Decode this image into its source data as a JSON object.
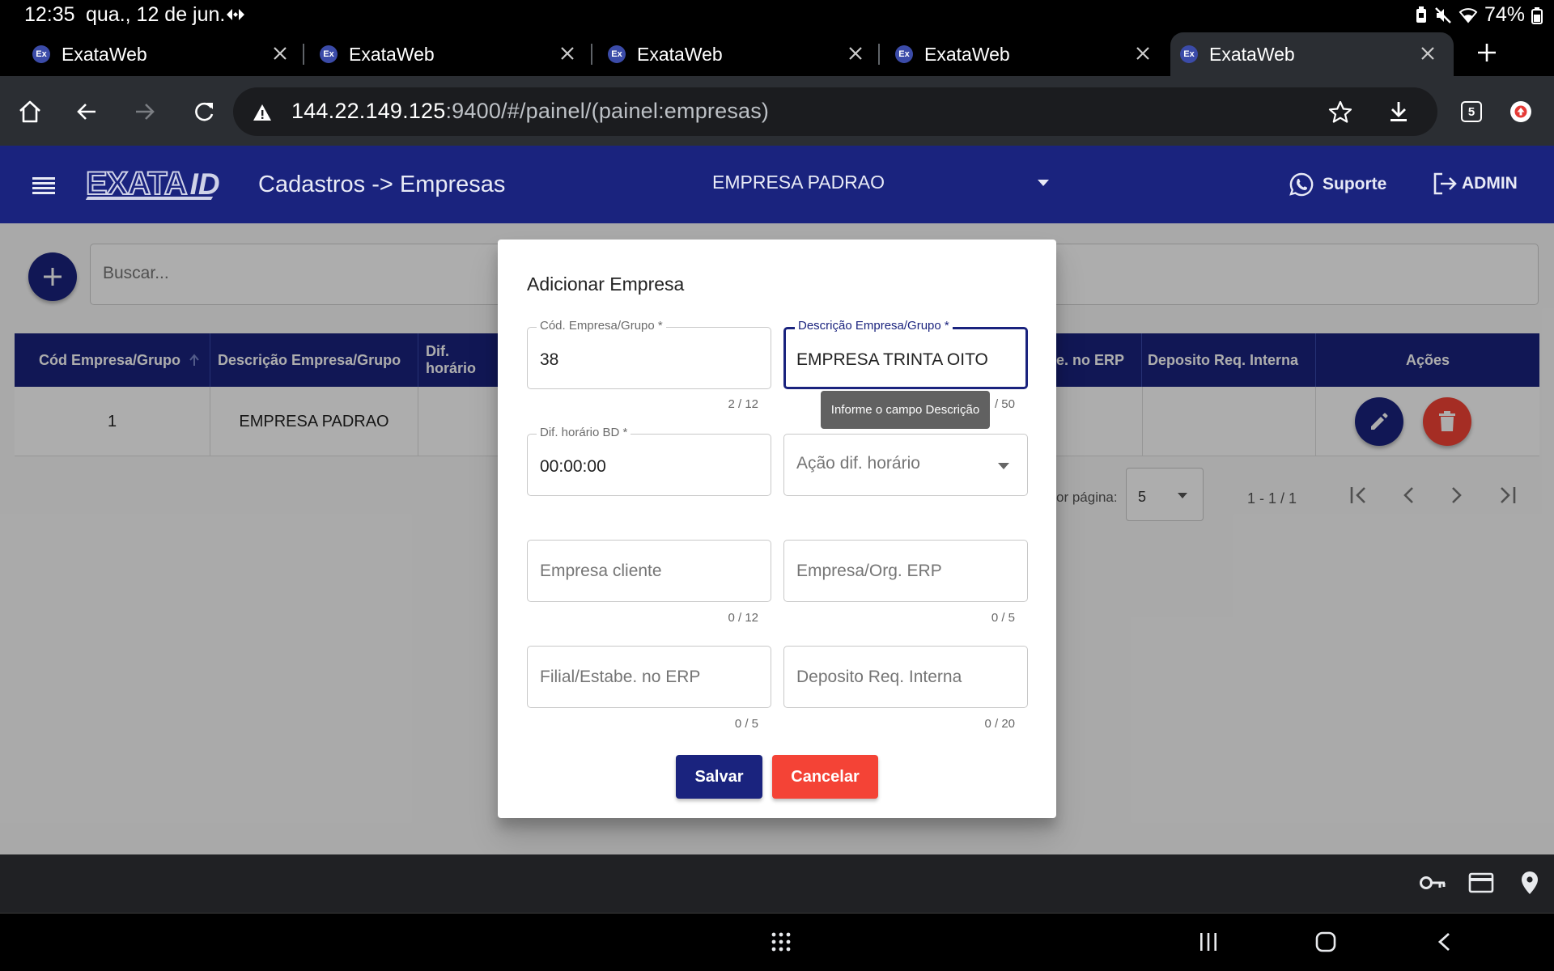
{
  "status_bar": {
    "time": "12:35",
    "date": "qua., 12 de jun.",
    "battery": "74%"
  },
  "browser": {
    "tabs": [
      {
        "title": "ExataWeb",
        "favicon": "Ex",
        "active": false
      },
      {
        "title": "ExataWeb",
        "favicon": "Ex",
        "active": false
      },
      {
        "title": "ExataWeb",
        "favicon": "Ex",
        "active": false
      },
      {
        "title": "ExataWeb",
        "favicon": "Ex",
        "active": false
      },
      {
        "title": "ExataWeb",
        "favicon": "Ex",
        "active": true
      }
    ],
    "url_host": "144.22.149.125",
    "url_rest": ":9400/#/painel/(painel:empresas)",
    "tab_count": "5"
  },
  "app": {
    "logo_left": "EXATA",
    "logo_right": "ID",
    "page_title": "Cadastros -> Empresas",
    "company": "EMPRESA PADRAO",
    "support_label": "Suporte",
    "user_label": "ADMIN",
    "colors": {
      "primary": "#1a237e",
      "danger": "#f44336"
    }
  },
  "search": {
    "placeholder": "Buscar..."
  },
  "table": {
    "columns": [
      "Cód Empresa/Grupo",
      "Descrição Empresa/Grupo",
      "Dif. horário",
      "e. no ERP",
      "Deposito Req. Interna",
      "Ações"
    ],
    "rows": [
      {
        "codigo": "1",
        "descricao": "EMPRESA PADRAO"
      }
    ]
  },
  "paginator": {
    "label": "or página:",
    "page_size": "5",
    "range": "1 - 1 / 1"
  },
  "modal": {
    "title": "Adicionar Empresa",
    "fields": {
      "codigo": {
        "label": "Cód. Empresa/Grupo *",
        "value": "38",
        "hint": "2 / 12"
      },
      "descricao": {
        "label": "Descrição Empresa/Grupo *",
        "value": "EMPRESA TRINTA OITO",
        "hint": "/ 50",
        "tooltip": "Informe o campo Descrição"
      },
      "dif_horario": {
        "label": "Dif. horário BD *",
        "value": "00:00:00"
      },
      "acao_dif": {
        "placeholder": "Ação dif. horário"
      },
      "empresa_cliente": {
        "placeholder": "Empresa cliente",
        "hint": "0 / 12"
      },
      "empresa_org_erp": {
        "placeholder": "Empresa/Org. ERP",
        "hint": "0 / 5"
      },
      "filial": {
        "placeholder": "Filial/Estabe. no ERP",
        "hint": "0 / 5"
      },
      "deposito": {
        "placeholder": "Deposito Req. Interna",
        "hint": "0 / 20"
      }
    },
    "save_label": "Salvar",
    "cancel_label": "Cancelar"
  }
}
